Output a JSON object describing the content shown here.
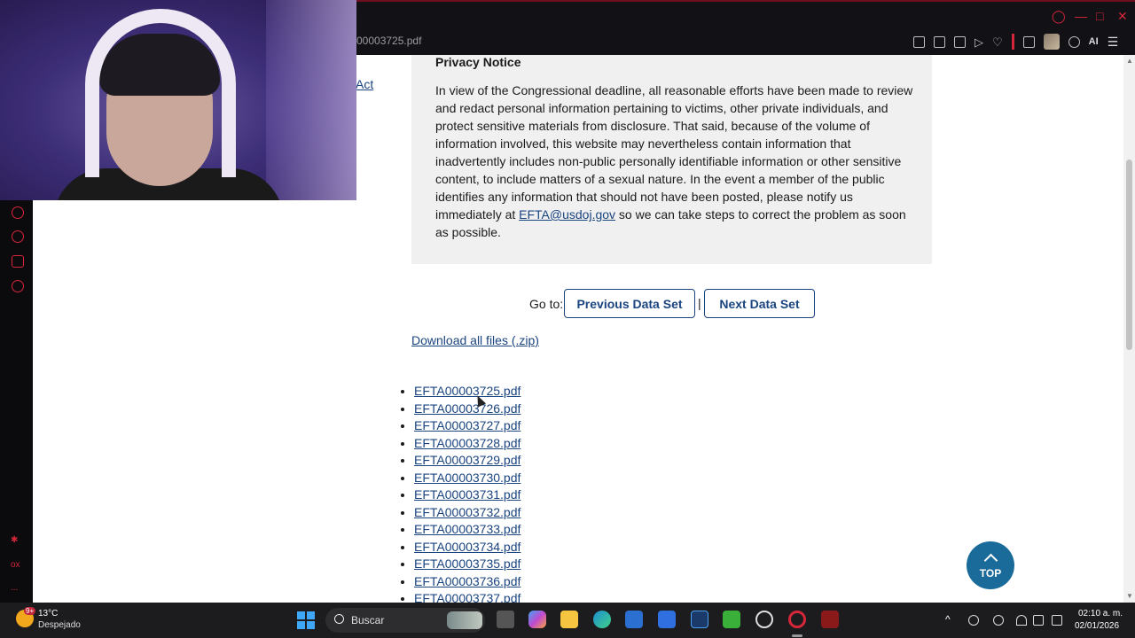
{
  "browser": {
    "tab_title": "00003725.pdf",
    "ai_label": "AI"
  },
  "page": {
    "side_link": "Act",
    "notice": {
      "title": "Privacy Notice",
      "body_before": "In view of the Congressional deadline, all reasonable efforts have been made to review and redact personal information pertaining to victims, other private individuals, and protect sensitive materials from disclosure.  That said, because of the volume of information involved, this website may nevertheless contain information that inadvertently includes non-public personally identifiable information or other sensitive content, to include matters of a sexual nature.  In the event a member of the public identifies any information that should not have been posted, please notify us immediately at ",
      "email": "EFTA@usdoj.gov",
      "body_after": " so we can take steps to correct the problem as soon as possible."
    },
    "goto_label": "Go to:",
    "prev_button": "Previous Data Set",
    "separator": "|",
    "next_button": "Next Data Set",
    "download_all": "Download all files (.zip)",
    "files": [
      "EFTA00003725.pdf",
      "EFTA00003726.pdf",
      "EFTA00003727.pdf",
      "EFTA00003728.pdf",
      "EFTA00003729.pdf",
      "EFTA00003730.pdf",
      "EFTA00003731.pdf",
      "EFTA00003732.pdf",
      "EFTA00003733.pdf",
      "EFTA00003734.pdf",
      "EFTA00003735.pdf",
      "EFTA00003736.pdf",
      "EFTA00003737.pdf"
    ],
    "top_button": "TOP"
  },
  "sidebar": {
    "bottom_label": "ox",
    "more_label": "..."
  },
  "taskbar": {
    "weather_temp": "13°C",
    "weather_desc": "Despejado",
    "weather_badge": "9+",
    "search_label": "Buscar",
    "time": "02:10 a. m.",
    "date": "02/01/2026"
  },
  "colors": {
    "link": "#1a4480",
    "opera_red": "#d6263a",
    "top_button_bg": "#1a6a9a",
    "notice_bg": "#f0f0f0"
  }
}
